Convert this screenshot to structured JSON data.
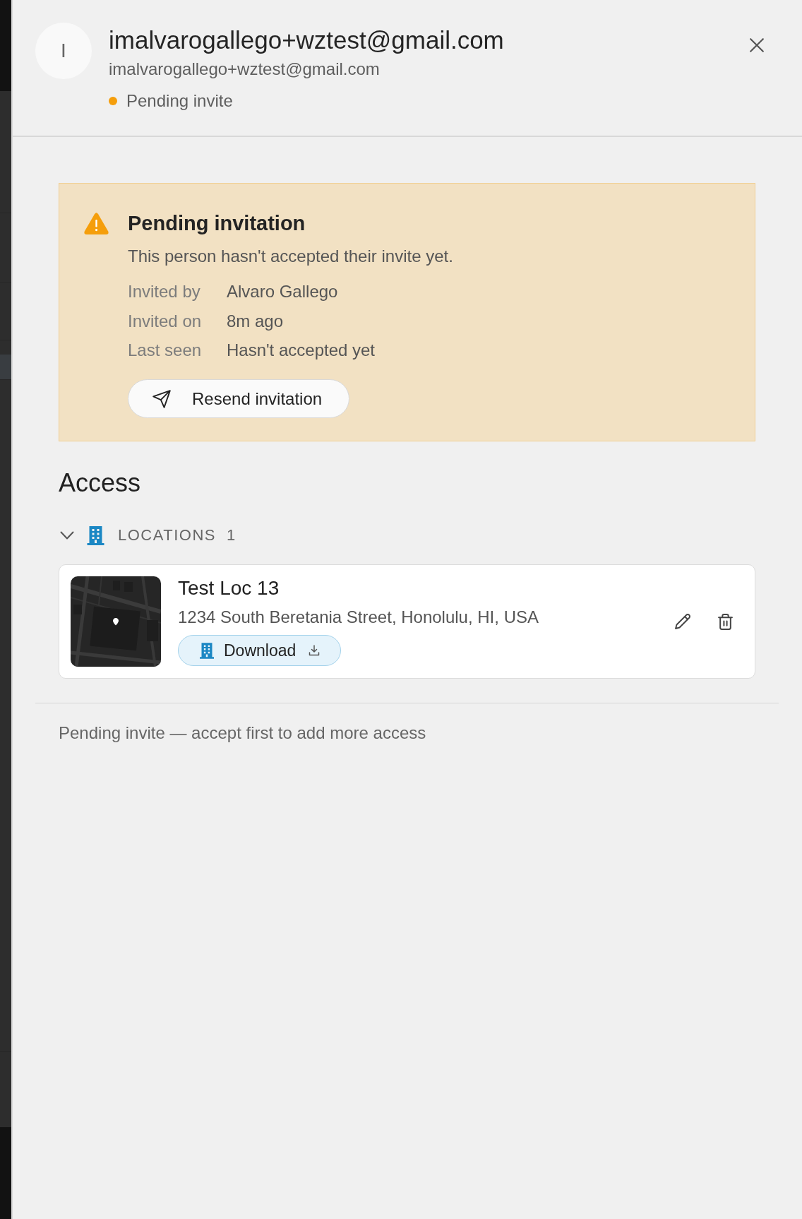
{
  "header": {
    "avatar_initial": "I",
    "title": "imalvarogallego+wztest@gmail.com",
    "subtitle": "imalvarogallego+wztest@gmail.com",
    "status": {
      "kind": "pending",
      "label": "Pending invite"
    }
  },
  "alert": {
    "kind": "warning",
    "title": "Pending invitation",
    "message": "This person hasn't accepted their invite yet.",
    "details": [
      {
        "label": "Invited by",
        "value": "Alvaro Gallego"
      },
      {
        "label": "Invited on",
        "value": "8m ago"
      },
      {
        "label": "Last seen",
        "value": "Hasn't accepted yet"
      }
    ],
    "button": "Resend invitation"
  },
  "access": {
    "heading": "Access",
    "groups": [
      {
        "label": "LOCATIONS",
        "count": "1",
        "expanded": true,
        "items": [
          {
            "name": "Test Loc 13",
            "address": "1234 South Beretania Street, Honolulu, HI, USA",
            "download_label": "Download"
          }
        ]
      }
    ],
    "note": "Pending invite — accept first to add more access"
  }
}
